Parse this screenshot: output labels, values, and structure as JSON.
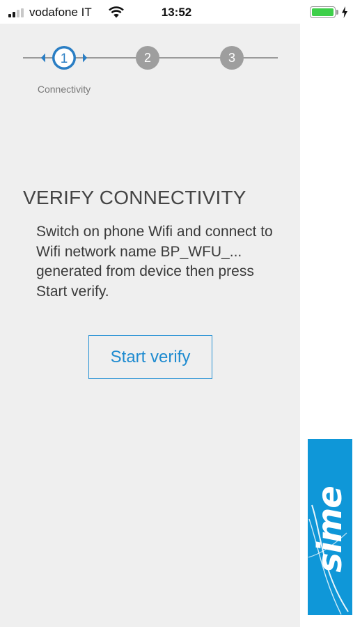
{
  "status_bar": {
    "carrier": "vodafone IT",
    "time": "13:52",
    "battery_level": 1.0,
    "icons": [
      "signal-icon",
      "wifi-icon",
      "battery-icon",
      "charging-bolt-icon"
    ]
  },
  "stepper": {
    "steps": [
      {
        "number": "1",
        "label": "Connectivity",
        "active": true
      },
      {
        "number": "2",
        "active": false
      },
      {
        "number": "3",
        "active": false
      }
    ]
  },
  "content": {
    "heading": "VERIFY CONNECTIVITY",
    "instructions": "Switch on phone Wifi and connect to Wifi network name BP_WFU_... generated from device then press Start verify.",
    "start_button": "Start verify"
  },
  "brand": {
    "logo_text": "sime"
  },
  "colors": {
    "accent_blue": "#1e8bd0",
    "brand_blue": "#0f97d8",
    "inactive_step": "#9e9e9e",
    "panel_bg": "#efefef",
    "battery_green": "#3ecf4a"
  }
}
